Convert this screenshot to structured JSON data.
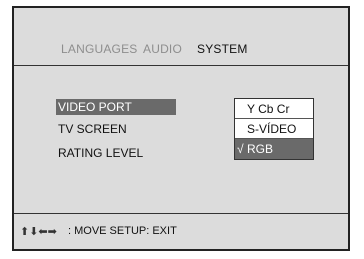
{
  "tabs": [
    {
      "label": "LANGUAGES"
    },
    {
      "label": "AUDIO"
    },
    {
      "label": "SYSTEM"
    }
  ],
  "menu": {
    "items": [
      {
        "label": "VIDEO PORT"
      },
      {
        "label": "TV SCREEN"
      },
      {
        "label": "RATING LEVEL"
      }
    ]
  },
  "popup": {
    "options": [
      {
        "label": "Y Cb Cr"
      },
      {
        "label": "S-VÍDEO"
      },
      {
        "label": "RGB",
        "check": "√"
      }
    ]
  },
  "footer": {
    "arrows": "⬆⬇⬅➡",
    "hint": ": MOVE   SETUP: EXIT"
  },
  "colors": {
    "panel_bg": "#dcdcdc",
    "highlight": "#6a6a6a",
    "inactive_tab": "#8e8e8e"
  }
}
